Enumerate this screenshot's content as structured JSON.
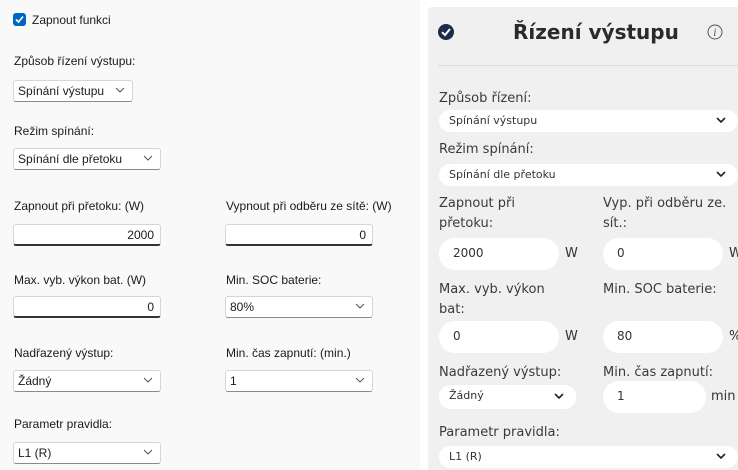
{
  "left": {
    "enable_label": "Zapnout funkci",
    "control_mode_label": "Způsob řízení výstupu:",
    "control_mode_value": "Spínání výstupu",
    "switch_mode_label": "Režim spínání:",
    "switch_mode_value": "Spínání dle přetoku",
    "on_overflow_label": "Zapnout při přetoku: (W)",
    "on_overflow_value": "2000",
    "off_grid_label": "Vypnout při odběru ze sítě: (W)",
    "off_grid_value": "0",
    "max_bat_label": "Max. vyb. výkon bat. (W)",
    "max_bat_value": "0",
    "min_soc_label": "Min. SOC baterie:",
    "min_soc_value": "80%",
    "parent_output_label": "Nadřazený výstup:",
    "parent_output_value": "Žádný",
    "min_on_time_label": "Min. čas zapnutí: (min.)",
    "min_on_time_value": "1",
    "rule_param_label": "Parametr pravidla:",
    "rule_param_value": "L1 (R)"
  },
  "right": {
    "title": "Řízení výstupu",
    "control_mode_label": "Způsob řízení:",
    "control_mode_value": "Spínání výstupu",
    "switch_mode_label": "Režim spínání:",
    "switch_mode_value": "Spínání dle přetoku",
    "on_overflow_label_1": "Zapnout při",
    "on_overflow_label_2": "přetoku:",
    "off_grid_label_1": "Vyp. při odběru ze.",
    "off_grid_label_2": "sít.:",
    "on_overflow_value": "2000",
    "on_overflow_unit": "W",
    "off_grid_value": "0",
    "off_grid_unit": "W",
    "max_bat_label_1": "Max. vyb. výkon",
    "max_bat_label_2": "bat:",
    "min_soc_label": "Min. SOC baterie:",
    "max_bat_value": "0",
    "max_bat_unit": "W",
    "min_soc_value": "80",
    "min_soc_unit": "%",
    "parent_output_label": "Nadřazený výstup:",
    "min_on_time_label": "Min. čas zapnutí:",
    "parent_output_value": "Žádný",
    "min_on_time_value": "1",
    "min_on_time_unit": "min",
    "rule_param_label": "Parametr pravidla:",
    "rule_param_value": "L1 (R)"
  }
}
